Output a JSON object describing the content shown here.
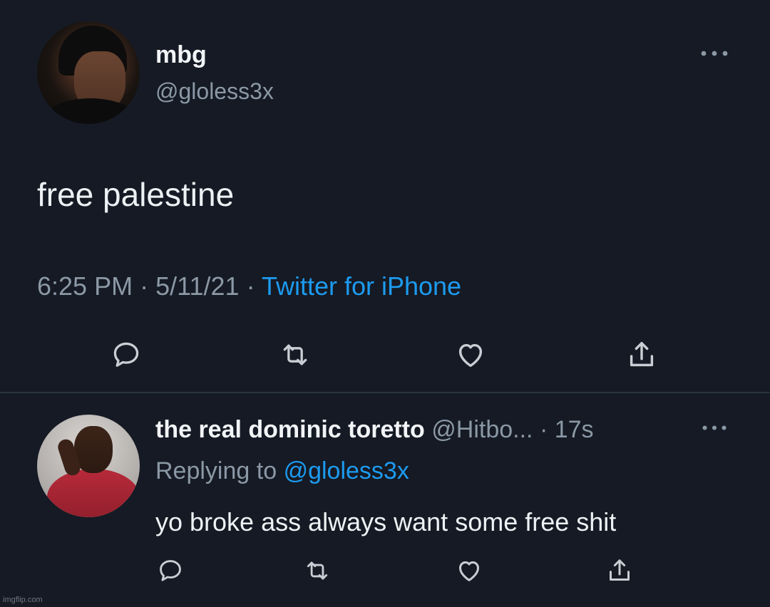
{
  "tweet": {
    "name": "mbg",
    "handle": "@gloless3x",
    "text": "free palestine",
    "time": "6:25 PM",
    "date": "5/11/21",
    "separator": "·",
    "source": "Twitter for iPhone",
    "more_icon": "more-horizontal-icon",
    "actions": [
      "reply-icon",
      "retweet-icon",
      "like-icon",
      "share-icon"
    ]
  },
  "reply": {
    "name": "the real dominic toretto",
    "handle": "@Hitbo...",
    "age": "· 17s",
    "replying_prefix": "Replying to",
    "replying_mention": "@gloless3x",
    "text": "yo broke ass always want some free shit",
    "more_icon": "more-horizontal-icon",
    "actions": [
      "reply-icon",
      "retweet-icon",
      "like-icon",
      "share-icon"
    ]
  },
  "watermark": "imgflip.com",
  "colors": {
    "background": "#151a24",
    "text": "#eef1f4",
    "secondary": "#8b98a5",
    "link": "#1d9bf0",
    "divider": "#2a313b"
  }
}
